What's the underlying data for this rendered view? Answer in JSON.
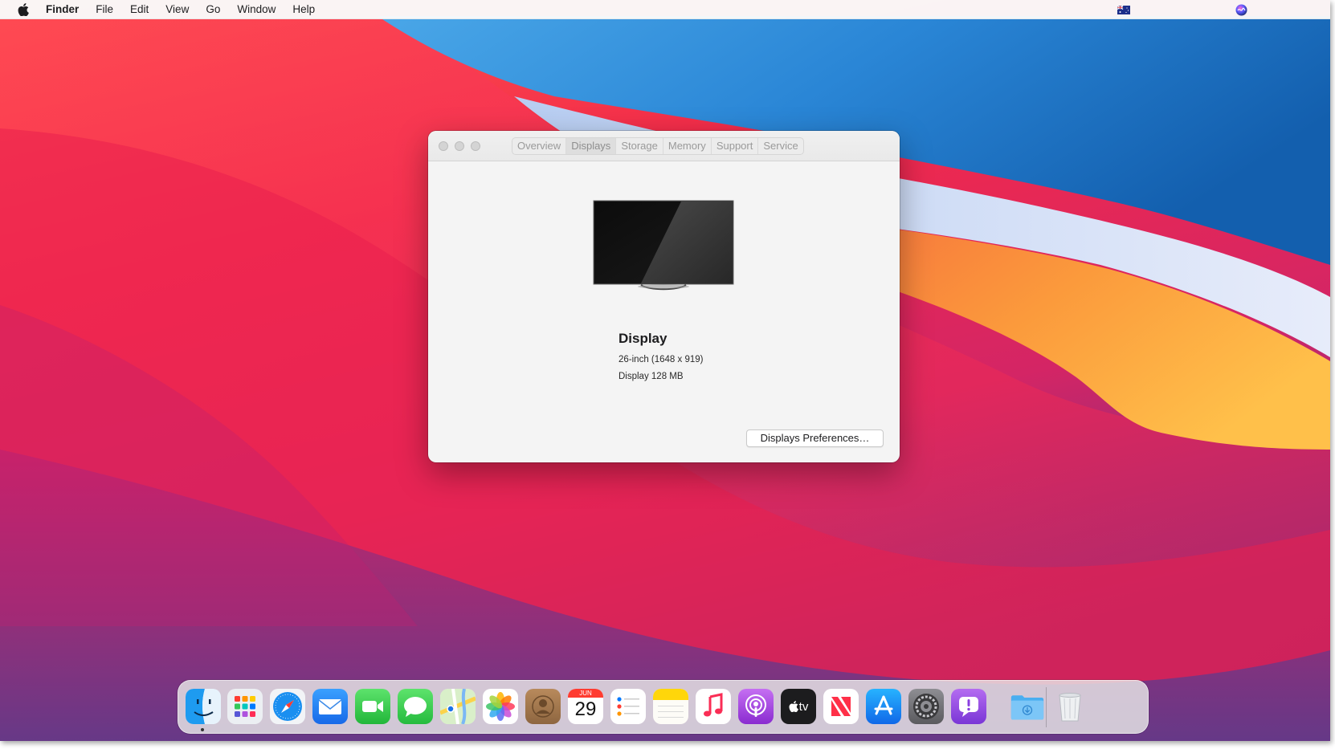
{
  "menubar": {
    "apple_icon": "apple-logo-icon",
    "items": [
      {
        "label": "Finder",
        "bold": true
      },
      {
        "label": "File"
      },
      {
        "label": "Edit"
      },
      {
        "label": "View"
      },
      {
        "label": "Go"
      },
      {
        "label": "Window"
      },
      {
        "label": "Help"
      }
    ],
    "status_icons": [
      "australian-flag-icon",
      "siri-icon"
    ]
  },
  "window": {
    "tabs": [
      {
        "label": "Overview"
      },
      {
        "label": "Displays",
        "active": true
      },
      {
        "label": "Storage"
      },
      {
        "label": "Memory"
      },
      {
        "label": "Support"
      },
      {
        "label": "Service"
      }
    ],
    "display": {
      "name": "Display",
      "size": "26-inch (1648 x 919)",
      "memory": "Display 128 MB"
    },
    "preferences_button": "Displays Preferences…"
  },
  "dock": {
    "calendar": {
      "month": "JUN",
      "day": "29"
    },
    "tv_label": "tv",
    "apps": [
      "finder-icon",
      "launchpad-icon",
      "safari-icon",
      "mail-icon",
      "facetime-icon",
      "messages-icon",
      "maps-icon",
      "photos-icon",
      "contacts-icon",
      "calendar-icon",
      "reminders-icon",
      "notes-icon",
      "music-icon",
      "podcasts-icon",
      "apple-tv-icon",
      "news-icon",
      "app-store-icon",
      "system-preferences-icon",
      "feedback-assistant-icon",
      "downloads-folder-icon",
      "trash-icon"
    ]
  },
  "colors": {
    "wallpaper_red": "#f0254b",
    "wallpaper_orange": "#fb9a3c",
    "wallpaper_blue": "#1b6fc0",
    "wallpaper_purple": "#6c2f86"
  }
}
